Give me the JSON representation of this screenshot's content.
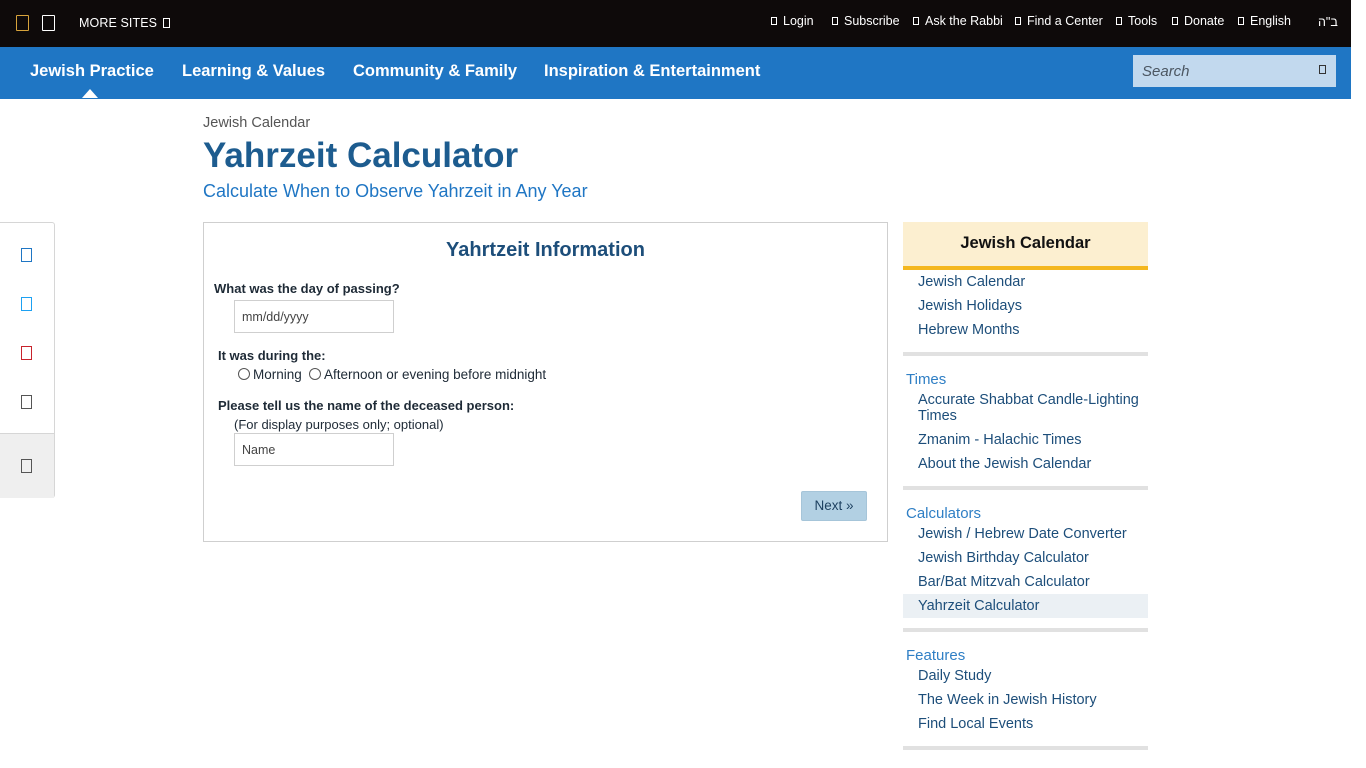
{
  "topbar": {
    "more_sites": "MORE SITES",
    "links": [
      "Login",
      "Subscribe",
      "Ask the Rabbi",
      "Find a Center",
      "Tools",
      "Donate",
      "English"
    ],
    "bh": "ב\"ה"
  },
  "nav": {
    "items": [
      "Jewish Practice",
      "Learning & Values",
      "Community & Family",
      "Inspiration & Entertainment"
    ],
    "search_placeholder": "Search"
  },
  "page": {
    "breadcrumb": "Jewish Calendar",
    "title": "Yahrzeit Calculator",
    "subtitle": "Calculate When to Observe Yahrzeit in Any Year"
  },
  "form": {
    "heading": "Yahrtzeit Information",
    "date_label": "What was the day of passing?",
    "date_placeholder": "mm/dd/yyyy",
    "time_label": "It was during the:",
    "time_options": [
      "Morning",
      "Afternoon or evening before midnight"
    ],
    "name_label": "Please tell us the name of the deceased person:",
    "name_note": "(For display purposes only; optional)",
    "name_placeholder": "Name",
    "next_label": "Next »"
  },
  "sidebar": {
    "heading": "Jewish Calendar",
    "top_links": [
      "Jewish Calendar",
      "Jewish Holidays",
      "Hebrew Months"
    ],
    "sections": [
      {
        "title": "Times",
        "links": [
          "Accurate Shabbat Candle-Lighting Times",
          "Zmanim - Halachic Times",
          "About the Jewish Calendar"
        ]
      },
      {
        "title": "Calculators",
        "links": [
          "Jewish / Hebrew Date Converter",
          "Jewish Birthday Calculator",
          "Bar/Bat Mitzvah Calculator",
          "Yahrzeit Calculator"
        ]
      },
      {
        "title": "Features",
        "links": [
          "Daily Study",
          "The Week in Jewish History",
          "Find Local Events"
        ]
      }
    ]
  },
  "share_icons": [
    "email-icon",
    "twitter-icon",
    "pinterest-icon",
    "print-icon",
    "comment-icon"
  ],
  "colors": {
    "topbar": "#0e0a0a",
    "nav": "#1f76c4",
    "title": "#1d5c8f",
    "accent_gold": "#f4b71f",
    "sidebar_head_bg": "#fcefd0"
  }
}
